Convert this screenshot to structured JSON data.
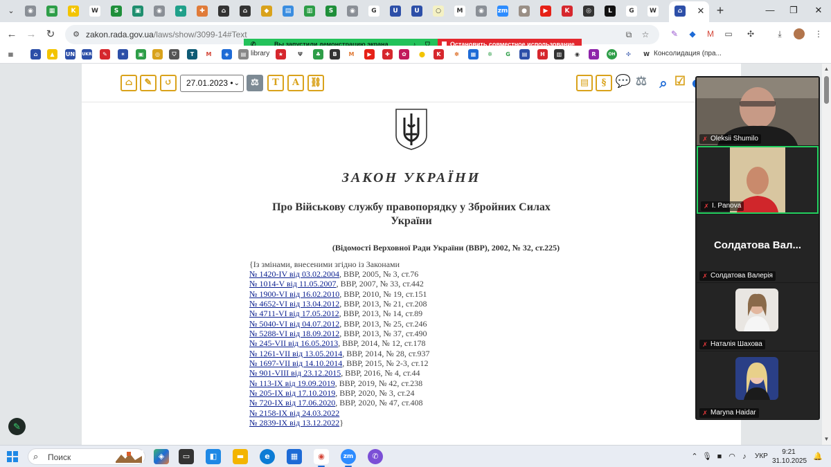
{
  "browser": {
    "tab_favicons": [
      {
        "name": "gray-globe-icon",
        "color": "#8a8f96",
        "glyph": "◉"
      },
      {
        "name": "green-news-icon",
        "color": "#2e9e48",
        "glyph": "▦"
      },
      {
        "name": "kplus-icon",
        "color": "#f3c400",
        "glyph": "K"
      },
      {
        "name": "wikipedia-icon",
        "color": "#ffffff",
        "glyph": "W"
      },
      {
        "name": "s-green-icon",
        "color": "#1f8f3a",
        "glyph": "S"
      },
      {
        "name": "teal-box-icon",
        "color": "#1f8f6f",
        "glyph": "▣"
      },
      {
        "name": "gray-globe-icon-2",
        "color": "#8a8f96",
        "glyph": "◉"
      },
      {
        "name": "rocket-icon",
        "color": "#20a08a",
        "glyph": "✦"
      },
      {
        "name": "orange-plus-icon",
        "color": "#e07b39",
        "glyph": "✚"
      },
      {
        "name": "court-icon",
        "color": "#333333",
        "glyph": "⌂"
      },
      {
        "name": "court-icon-2",
        "color": "#333333",
        "glyph": "⌂"
      },
      {
        "name": "gov-icon",
        "color": "#d9a21b",
        "glyph": "◆"
      },
      {
        "name": "blue-docs-icon",
        "color": "#3a8de0",
        "glyph": "▤"
      },
      {
        "name": "green-chart-icon",
        "color": "#2e9e48",
        "glyph": "▥"
      },
      {
        "name": "s-green-icon-2",
        "color": "#1f8f3a",
        "glyph": "S"
      },
      {
        "name": "gray-globe-icon-3",
        "color": "#8a8f96",
        "glyph": "◉"
      },
      {
        "name": "google-icon",
        "color": "#ffffff",
        "glyph": "G"
      },
      {
        "name": "law-blue-icon",
        "color": "#2d4fa8",
        "glyph": "U"
      },
      {
        "name": "law-blue-icon-2",
        "color": "#2d4fa8",
        "glyph": "U"
      },
      {
        "name": "light-circle-icon",
        "color": "#f4f1c4",
        "glyph": "○"
      },
      {
        "name": "gmail-icon",
        "color": "#ffffff",
        "glyph": "M"
      },
      {
        "name": "gray-globe-icon-4",
        "color": "#8a8f96",
        "glyph": "◉"
      },
      {
        "name": "zoom-icon",
        "color": "#2d8cff",
        "glyph": "zm"
      },
      {
        "name": "avatar-tab-icon",
        "color": "#9a8f86",
        "glyph": "●"
      },
      {
        "name": "youtube-icon",
        "color": "#e62117",
        "glyph": "▶"
      },
      {
        "name": "k-red-icon",
        "color": "#d6272d",
        "glyph": "K"
      },
      {
        "name": "black-ring-icon",
        "color": "#333333",
        "glyph": "◎"
      },
      {
        "name": "l-black-icon",
        "color": "#111111",
        "glyph": "L"
      },
      {
        "name": "google-icon-2",
        "color": "#ffffff",
        "glyph": "G"
      },
      {
        "name": "wikipedia-icon-2",
        "color": "#ffffff",
        "glyph": "W"
      },
      {
        "name": "rada-icon",
        "color": "#2d4fa8",
        "glyph": "⌂"
      }
    ],
    "new_tab_glyph": "+",
    "url_domain": "zakon.rada.gov.ua",
    "url_path": "/laws/show/3099-14#Text"
  },
  "share_banner": {
    "message": "Вы запустили демонстрацию экрана",
    "stop_label": "Остановить совместное использование",
    "green": "#23c25a",
    "red": "#e3282e"
  },
  "bookmarks": {
    "library_label": "library",
    "consolidation_label": "Консолидация (пра..."
  },
  "doc_toolbar": {
    "date_value": "27.01.2023 •"
  },
  "document": {
    "title": "ЗАКОН УКРАЇНИ",
    "subtitle": "Про Військову службу правопорядку у Збройних Силах України",
    "source": "(Відомості Верховної Ради України (ВВР), 2002, № 32, ст.225)",
    "amend_head": "{Із змінами, внесеними згідно із Законами",
    "amendments": [
      {
        "link": "№ 1420-IV від 03.02.2004",
        "rest": ", ВВР, 2005, №  3, ст.76"
      },
      {
        "link": "№ 1014-V від 11.05.2007",
        "rest": ", ВВР, 2007, № 33, ст.442"
      },
      {
        "link": "№ 1900-VI від 16.02.2010",
        "rest": ", ВВР, 2010, № 19, ст.151"
      },
      {
        "link": "№ 4652-VI від 13.04.2012",
        "rest": ", ВВР, 2013, № 21, ст.208"
      },
      {
        "link": "№ 4711-VI від 17.05.2012",
        "rest": ", ВВР, 2013, № 14, ст.89"
      },
      {
        "link": "№ 5040-VI від 04.07.2012",
        "rest": ", ВВР, 2013, № 25, ст.246"
      },
      {
        "link": "№ 5288-VI від 18.09.2012",
        "rest": ", ВВР, 2013, № 37, ст.490"
      },
      {
        "link": "№ 245-VII від 16.05.2013",
        "rest": ", ВВР, 2014, № 12, ст.178"
      },
      {
        "link": "№ 1261-VII від 13.05.2014",
        "rest": ", ВВР, 2014, № 28, ст.937"
      },
      {
        "link": "№ 1697-VII від 14.10.2014",
        "rest": ", ВВР, 2015, № 2-3, ст.12"
      },
      {
        "link": "№ 901-VIII від 23.12.2015",
        "rest": ", ВВР, 2016, № 4, ст.44"
      },
      {
        "link": "№ 113-IX від 19.09.2019",
        "rest": ", ВВР, 2019, № 42, ст.238"
      },
      {
        "link": "№ 205-IX від 17.10.2019",
        "rest": ", ВВР, 2020, № 3, ст.24"
      },
      {
        "link": "№ 720-IX від 17.06.2020",
        "rest": ", ВВР, 2020, № 47, ст.408"
      },
      {
        "link": "№ 2158-IX від 24.03.2022",
        "rest": ""
      },
      {
        "link": "№ 2839-IX від 13.12.2022",
        "rest": "}"
      }
    ]
  },
  "zoom": {
    "participants": [
      {
        "name": "Oleksii Shumilo",
        "type": "video"
      },
      {
        "name": "I. Panova",
        "type": "video",
        "active": true
      },
      {
        "name": "Солдатова Валерія",
        "big_label": "Солдатова Вал...",
        "type": "name"
      },
      {
        "name": "Наталія Шахова",
        "type": "avatar"
      },
      {
        "name": "Maryna Haidar",
        "type": "avatar"
      }
    ],
    "active_border": "#23d160"
  },
  "taskbar": {
    "search_label": "Поиск",
    "lang": "УКР",
    "time": "9:21",
    "date": "31.10.2025"
  }
}
